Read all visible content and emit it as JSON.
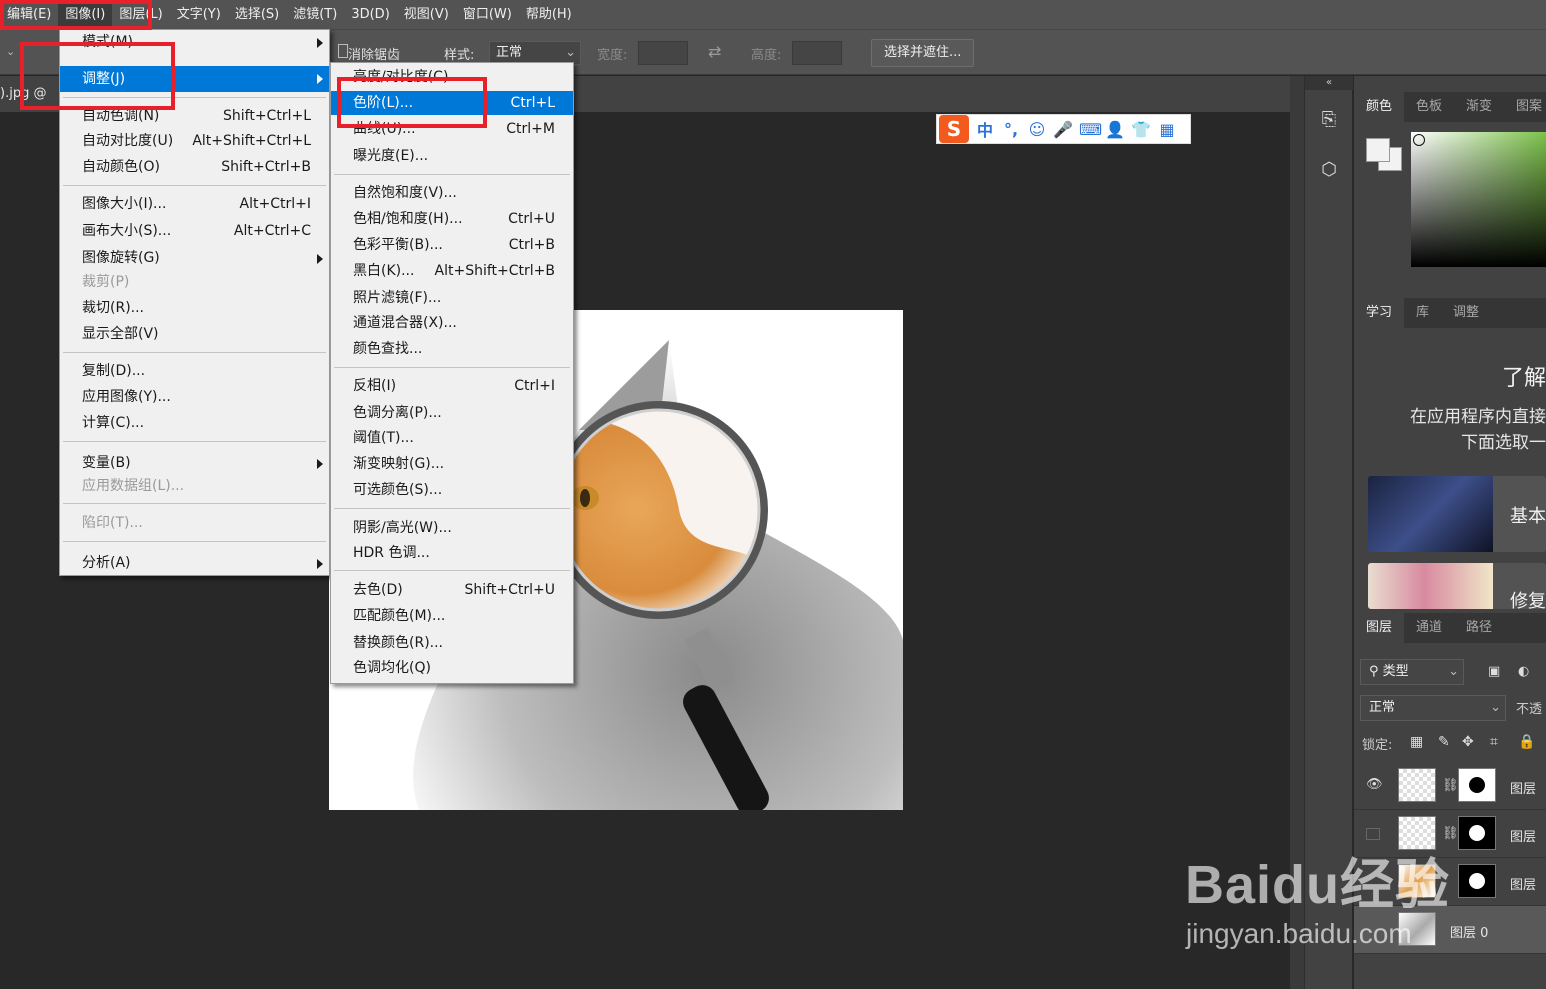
{
  "menubar": {
    "items": [
      "编辑(E)",
      "图像(I)",
      "图层(L)",
      "文字(Y)",
      "选择(S)",
      "滤镜(T)",
      "3D(D)",
      "视图(V)",
      "窗口(W)",
      "帮助(H)"
    ]
  },
  "options": {
    "antialias": "消除锯齿",
    "style_label": "样式:",
    "style_value": "正常",
    "width_label": "宽度:",
    "height_label": "高度:",
    "select_mask_button": "选择并遮住..."
  },
  "doc_tab": {
    "label": ").jpg @"
  },
  "image_menu": {
    "items": [
      {
        "label": "模式(M)",
        "shortcut": "",
        "submenu": true,
        "disabled": false
      },
      {
        "label": "调整(J)",
        "shortcut": "",
        "submenu": true,
        "disabled": false,
        "highlighted": true
      },
      {
        "label": "自动色调(N)",
        "shortcut": "Shift+Ctrl+L"
      },
      {
        "label": "自动对比度(U)",
        "shortcut": "Alt+Shift+Ctrl+L"
      },
      {
        "label": "自动颜色(O)",
        "shortcut": "Shift+Ctrl+B"
      },
      {
        "label": "图像大小(I)...",
        "shortcut": "Alt+Ctrl+I"
      },
      {
        "label": "画布大小(S)...",
        "shortcut": "Alt+Ctrl+C"
      },
      {
        "label": "图像旋转(G)",
        "shortcut": "",
        "submenu": true
      },
      {
        "label": "裁剪(P)",
        "shortcut": "",
        "disabled": true
      },
      {
        "label": "裁切(R)...",
        "shortcut": ""
      },
      {
        "label": "显示全部(V)",
        "shortcut": ""
      },
      {
        "label": "复制(D)...",
        "shortcut": ""
      },
      {
        "label": "应用图像(Y)...",
        "shortcut": ""
      },
      {
        "label": "计算(C)...",
        "shortcut": ""
      },
      {
        "label": "变量(B)",
        "shortcut": "",
        "submenu": true
      },
      {
        "label": "应用数据组(L)...",
        "shortcut": "",
        "disabled": true
      },
      {
        "label": "陷印(T)...",
        "shortcut": "",
        "disabled": true
      },
      {
        "label": "分析(A)",
        "shortcut": "",
        "submenu": true
      }
    ]
  },
  "adjust_menu": {
    "items": [
      {
        "label": "亮度/对比度(C)...",
        "shortcut": ""
      },
      {
        "label": "色阶(L)...",
        "shortcut": "Ctrl+L",
        "highlighted": true
      },
      {
        "label": "曲线(U)...",
        "shortcut": "Ctrl+M"
      },
      {
        "label": "曝光度(E)...",
        "shortcut": ""
      },
      {
        "label": "自然饱和度(V)...",
        "shortcut": ""
      },
      {
        "label": "色相/饱和度(H)...",
        "shortcut": "Ctrl+U"
      },
      {
        "label": "色彩平衡(B)...",
        "shortcut": "Ctrl+B"
      },
      {
        "label": "黑白(K)...",
        "shortcut": "Alt+Shift+Ctrl+B"
      },
      {
        "label": "照片滤镜(F)...",
        "shortcut": ""
      },
      {
        "label": "通道混合器(X)...",
        "shortcut": ""
      },
      {
        "label": "颜色查找...",
        "shortcut": ""
      },
      {
        "label": "反相(I)",
        "shortcut": "Ctrl+I"
      },
      {
        "label": "色调分离(P)...",
        "shortcut": ""
      },
      {
        "label": "阈值(T)...",
        "shortcut": ""
      },
      {
        "label": "渐变映射(G)...",
        "shortcut": ""
      },
      {
        "label": "可选颜色(S)...",
        "shortcut": ""
      },
      {
        "label": "阴影/高光(W)...",
        "shortcut": ""
      },
      {
        "label": "HDR 色调...",
        "shortcut": ""
      },
      {
        "label": "去色(D)",
        "shortcut": "Shift+Ctrl+U"
      },
      {
        "label": "匹配颜色(M)...",
        "shortcut": ""
      },
      {
        "label": "替换颜色(R)...",
        "shortcut": ""
      },
      {
        "label": "色调均化(Q)",
        "shortcut": ""
      }
    ]
  },
  "ime": {
    "glyphs": [
      "中",
      "°,",
      "☺",
      "🎤",
      "⌨",
      "👤",
      "👕",
      "▦"
    ]
  },
  "panels": {
    "color_tabs": [
      "颜色",
      "色板",
      "渐变",
      "图案"
    ],
    "learn_tabs": [
      "学习",
      "库",
      "调整"
    ],
    "learn_title": "了解",
    "learn_line1": "在应用程序内直接",
    "learn_line2": "下面选取一",
    "card1": "基本",
    "card2": "修复",
    "layers_tabs": [
      "图层",
      "通道",
      "路径"
    ],
    "filter_label": "类型",
    "blend_mode": "正常",
    "opacity_label": "不透",
    "lock_label": "锁定:",
    "layers": [
      {
        "name": "图层"
      },
      {
        "name": "图层"
      },
      {
        "name": "图层"
      },
      {
        "name": "图层 0"
      }
    ]
  },
  "watermark": {
    "logo": "Baidu经验",
    "url": "jingyan.baidu.com"
  },
  "colors": {
    "highlight": "#0078d7",
    "annotation": "#e8202a",
    "menu_bg": "#f0f0f0"
  }
}
